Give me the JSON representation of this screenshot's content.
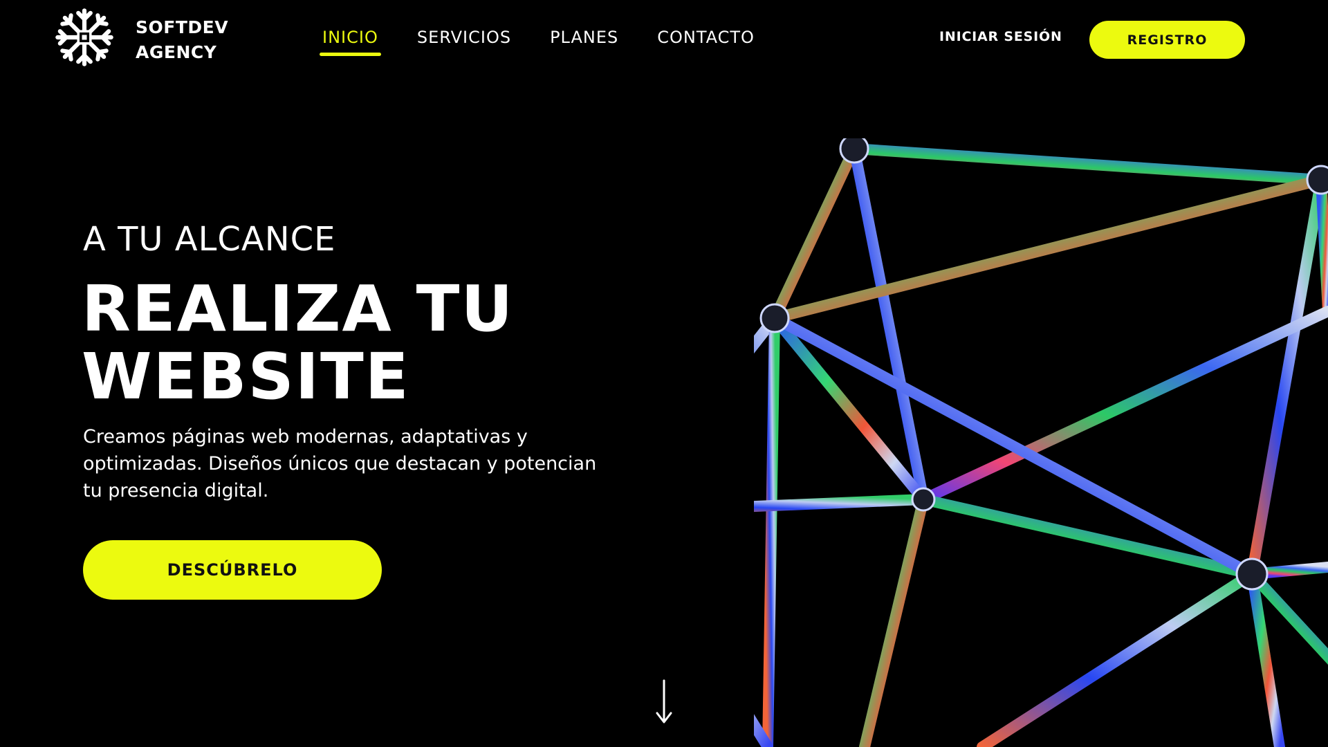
{
  "brand": {
    "name_line1": "SOFTDEV",
    "name_line2": "AGENCY",
    "logo_icon": "snowflake-emblem-icon"
  },
  "nav": {
    "items": [
      {
        "label": "INICIO",
        "active": true
      },
      {
        "label": "SERVICIOS",
        "active": false
      },
      {
        "label": "PLANES",
        "active": false
      },
      {
        "label": "CONTACTO",
        "active": false
      }
    ]
  },
  "auth": {
    "login_label": "INICIAR SESIÓN",
    "register_label": "REGISTRO"
  },
  "hero": {
    "eyebrow": "A TU ALCANCE",
    "headline_line1": "REALIZA TU",
    "headline_line2": "WEBSITE",
    "description_line1": "Creamos páginas web modernas, adaptativas y",
    "description_line2": "optimizadas. Diseños únicos que destacan y potencian",
    "description_line3": "tu presencia digital.",
    "cta_label": "DESCÚBRELO",
    "scroll_icon": "arrow-down-icon",
    "graphic": "iridescent-icosahedron-wireframe"
  },
  "colors": {
    "background": "#000000",
    "accent": "#ecfa0f",
    "text": "#ffffff",
    "button_text": "#111111"
  }
}
